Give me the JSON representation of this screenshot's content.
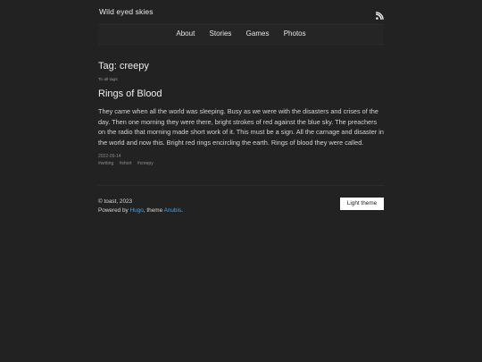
{
  "site": {
    "title": "Wild eyed skies",
    "rss_icon": "rss-icon"
  },
  "nav": {
    "items": [
      {
        "label": "About"
      },
      {
        "label": "Stories"
      },
      {
        "label": "Games"
      },
      {
        "label": "Photos"
      }
    ]
  },
  "main": {
    "heading": "Tag: creepy",
    "all_tags_link": "To all tags",
    "post": {
      "title": "Rings of Blood",
      "body": "They came when all the world was sleeping. Busy as we were with the disasters and crises of the day. Then one morning they were there, bright strokes of red against the blue sky. The preachers on the radio that morning made short work of it. This must be a sign. All the carnage and disaster in the world and now this. Bright red rings encircling the earth. Rings of blood they were called.",
      "date": "2022-09-14",
      "tags": [
        "#writing",
        "#short",
        "#creepy"
      ]
    }
  },
  "footer": {
    "copyright": "© toast, 2023",
    "powered_prefix": "Powered by ",
    "hugo_link": "Hugo",
    "theme_mid": ", theme ",
    "anubis_link": "Anubis",
    "end": ".",
    "theme_button": "Light theme"
  },
  "colors": {
    "background": "#222222",
    "link": "#5b9fd6"
  }
}
